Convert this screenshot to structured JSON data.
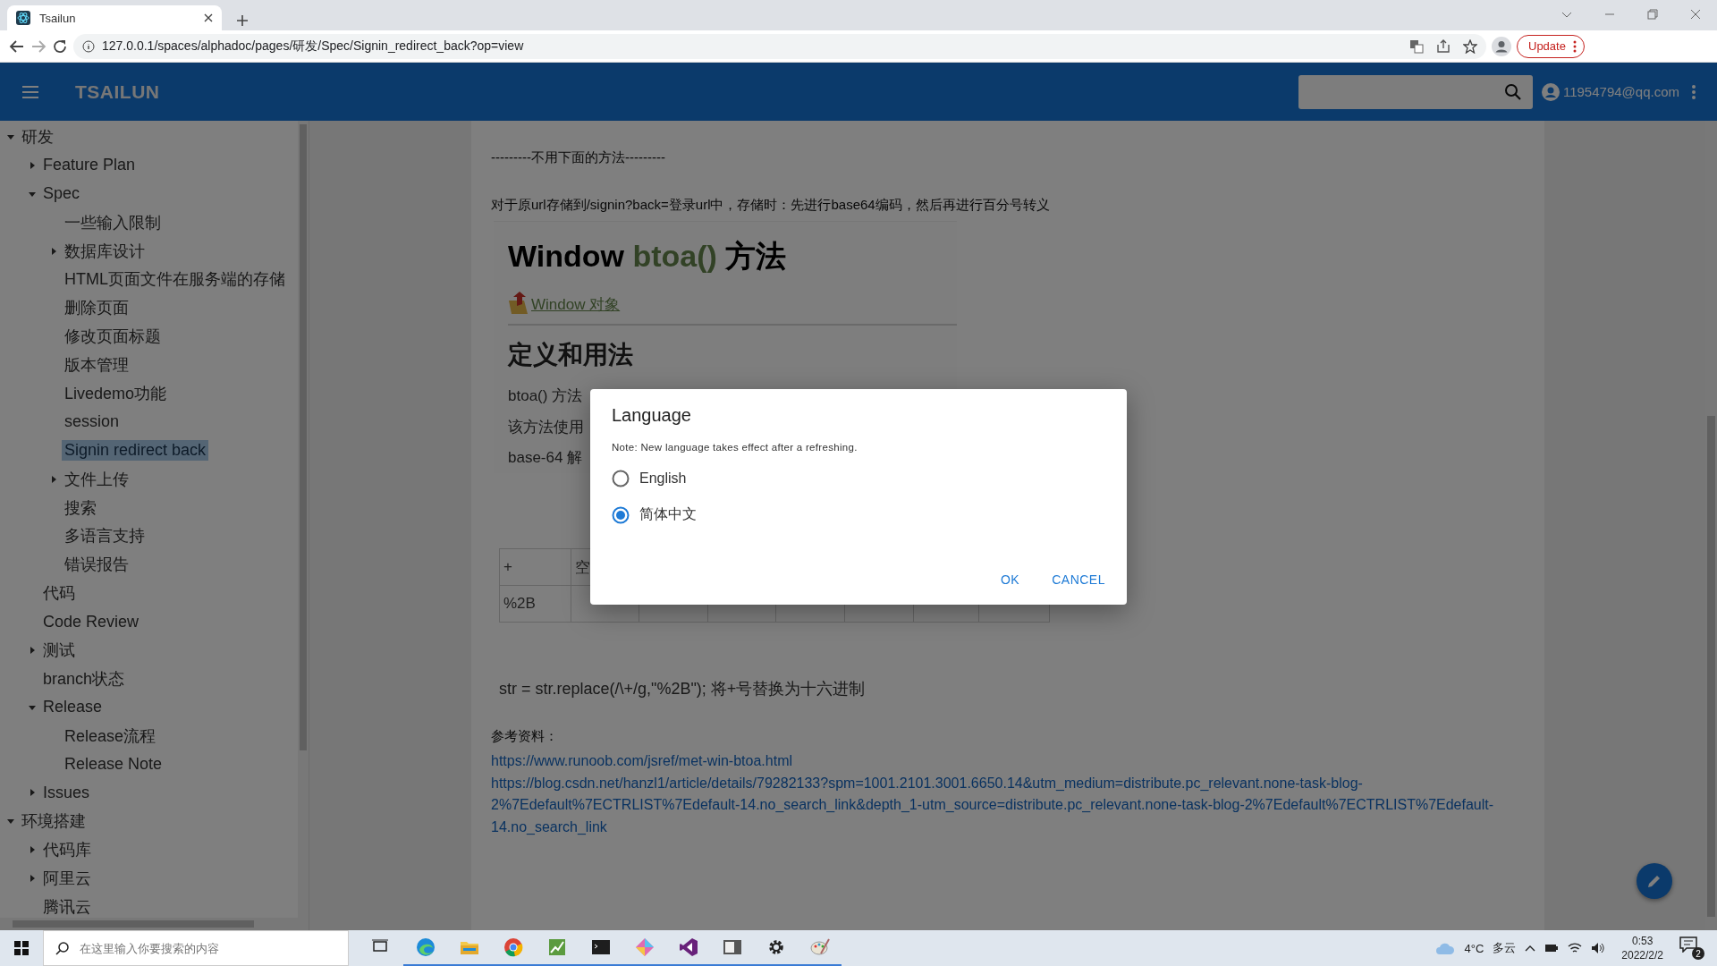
{
  "browser": {
    "tab": {
      "title": "Tsailun"
    },
    "address": "127.0.0.1/spaces/alphadoc/pages/研发/Spec/Signin_redirect_back?op=view",
    "update_button": "Update"
  },
  "header": {
    "title": "TSAILUN",
    "user": "11954794@qq.com"
  },
  "sidebar": {
    "items": [
      {
        "label": "研发",
        "kind": "group",
        "expanded": true,
        "selected": false,
        "children": [
          {
            "label": "Feature Plan",
            "kind": "group",
            "expanded": false,
            "selected": false
          },
          {
            "label": "Spec",
            "kind": "group",
            "expanded": true,
            "selected": false,
            "children": [
              {
                "label": "一些输入限制",
                "kind": "page",
                "selected": false
              },
              {
                "label": "数据库设计",
                "kind": "group",
                "expanded": false,
                "selected": false
              },
              {
                "label": "HTML页面文件在服务端的存储",
                "kind": "page",
                "selected": false
              },
              {
                "label": "删除页面",
                "kind": "page",
                "selected": false
              },
              {
                "label": "修改页面标题",
                "kind": "page",
                "selected": false
              },
              {
                "label": "版本管理",
                "kind": "page",
                "selected": false
              },
              {
                "label": "Livedemo功能",
                "kind": "page",
                "selected": false
              },
              {
                "label": "session",
                "kind": "page",
                "selected": false
              },
              {
                "label": "Signin redirect back",
                "kind": "page",
                "selected": true
              },
              {
                "label": "文件上传",
                "kind": "group",
                "expanded": false,
                "selected": false
              },
              {
                "label": "搜索",
                "kind": "page",
                "selected": false
              },
              {
                "label": "多语言支持",
                "kind": "page",
                "selected": false
              },
              {
                "label": "错误报告",
                "kind": "page",
                "selected": false
              }
            ]
          },
          {
            "label": "代码",
            "kind": "page",
            "selected": false
          },
          {
            "label": "Code Review",
            "kind": "page",
            "selected": false
          },
          {
            "label": "测试",
            "kind": "group",
            "expanded": false,
            "selected": false
          },
          {
            "label": "branch状态",
            "kind": "page",
            "selected": false
          },
          {
            "label": "Release",
            "kind": "group",
            "expanded": true,
            "selected": false,
            "children": [
              {
                "label": "Release流程",
                "kind": "page",
                "selected": false
              },
              {
                "label": "Release Note",
                "kind": "page",
                "selected": false
              }
            ]
          },
          {
            "label": "Issues",
            "kind": "group",
            "expanded": false,
            "selected": false
          }
        ]
      },
      {
        "label": "环境搭建",
        "kind": "group",
        "expanded": true,
        "selected": false,
        "children": [
          {
            "label": "代码库",
            "kind": "group",
            "expanded": false,
            "selected": false
          },
          {
            "label": "阿里云",
            "kind": "group",
            "expanded": false,
            "selected": false
          },
          {
            "label": "腾讯云",
            "kind": "page",
            "selected": false
          }
        ]
      }
    ]
  },
  "content": {
    "separator_note": "---------不用下面的方法---------",
    "intro": "对于原url存储到/signin?back=登录url中，存储时：先进行base64编码，然后再进行百分号转义",
    "embedded": {
      "heading": [
        "Window ",
        "btoa()",
        " 方法"
      ],
      "link": "Window 对象",
      "subheading": "定义和用法",
      "lines": [
        "btoa() 方法",
        "该方法使用",
        "base-64 解"
      ]
    },
    "table": {
      "rows": [
        [
          "+",
          "空"
        ],
        [
          "%2B"
        ]
      ]
    },
    "code_line": "str = str.replace(/\\+/g,\"%2B\"); 将+号替换为十六进制",
    "references_label": "参考资料：",
    "links": [
      "https://www.runoob.com/jsref/met-win-btoa.html",
      "https://blog.csdn.net/hanzl1/article/details/79282133?spm=1001.2101.3001.6650.14&utm_medium=distribute.pc_relevant.none-task-blog-2%7Edefault%7ECTRLIST%7Edefault-14.no_search_link&depth_1-utm_source=distribute.pc_relevant.none-task-blog-2%7Edefault%7ECTRLIST%7Edefault-14.no_search_link"
    ]
  },
  "dialog": {
    "title": "Language",
    "note": "Note: New language takes effect after a refreshing.",
    "options": [
      {
        "label": "English",
        "selected": false
      },
      {
        "label": "简体中文",
        "selected": true
      }
    ],
    "buttons": [
      "OK",
      "CANCEL"
    ]
  },
  "taskbar": {
    "search_placeholder": "在这里输入你要搜索的内容",
    "temperature": "4°C",
    "weather": "多云",
    "time": "0:53",
    "date": "2022/2/2",
    "notifications": "2"
  }
}
